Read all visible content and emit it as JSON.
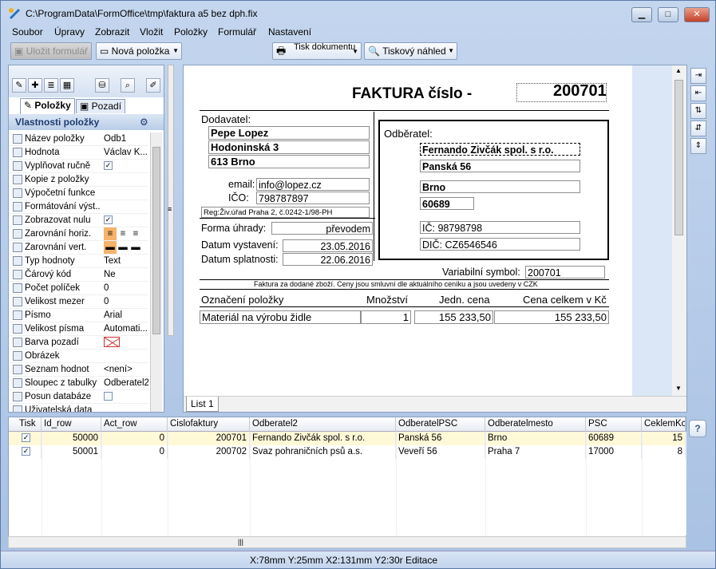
{
  "window": {
    "title": "C:\\ProgramData\\FormOffice\\tmp\\faktura a5 bez dph.fix",
    "min": "▁",
    "max": "□",
    "close": "✕"
  },
  "menu": [
    "Soubor",
    "Úpravy",
    "Zobrazit",
    "Vložit",
    "Položky",
    "Formulář",
    "Nastavení"
  ],
  "toolbar": {
    "save": "Uložit formulář",
    "new_item": "Nová položka",
    "print": "Tisk dokumentu",
    "preview": "Tiskový náhled"
  },
  "left_tabs": {
    "polozky": "Položky",
    "pozadi": "Pozadí"
  },
  "props_header": "Vlastnosti položky",
  "props": [
    {
      "name": "Název položky",
      "value": "Odb1",
      "icon": "label-icon"
    },
    {
      "name": "Hodnota",
      "value": "Václav K...",
      "icon": "value-icon"
    },
    {
      "name": "Vyplňovat ručně",
      "value": "check",
      "icon": "edit-icon"
    },
    {
      "name": "Kopie z položky",
      "value": "",
      "icon": "copy-icon"
    },
    {
      "name": "Výpočetní funkce",
      "value": "",
      "icon": "lightning-icon"
    },
    {
      "name": "Formátování výst...",
      "value": "",
      "icon": "format-icon"
    },
    {
      "name": "Zobrazovat nulu",
      "value": "check",
      "icon": "zero-icon"
    },
    {
      "name": "Zarovnání horiz.",
      "value": "align-h",
      "icon": "align-h-icon"
    },
    {
      "name": "Zarovnání vert.",
      "value": "align-v",
      "icon": "align-v-icon"
    },
    {
      "name": "Typ hodnoty",
      "value": "Text",
      "icon": "type-icon"
    },
    {
      "name": "Čárový kód",
      "value": "Ne",
      "icon": "barcode-icon"
    },
    {
      "name": "Počet políček",
      "value": "0",
      "icon": "count-icon"
    },
    {
      "name": "Velikost mezer",
      "value": "0",
      "icon": "spacing-icon"
    },
    {
      "name": "Písmo",
      "value": "Arial",
      "icon": "font-icon"
    },
    {
      "name": "Velikost písma",
      "value": "Automati...",
      "icon": "font-size-icon"
    },
    {
      "name": "Barva pozadí",
      "value": "none",
      "icon": "color-icon"
    },
    {
      "name": "Obrázek",
      "value": "",
      "icon": "image-icon"
    },
    {
      "name": "Seznam hodnot",
      "value": "<není>",
      "icon": "list-icon"
    },
    {
      "name": "Sloupec z tabulky",
      "value": "Odberatel2",
      "icon": "column-icon"
    },
    {
      "name": "Posun databáze",
      "value": "uncheck",
      "icon": "db-icon"
    },
    {
      "name": "Uživatelská data",
      "value": "",
      "icon": "user-data-icon"
    }
  ],
  "invoice": {
    "title": "FAKTURA číslo -",
    "number": "200701",
    "dodavatel_label": "Dodavatel:",
    "sup_name": "Pepe Lopez",
    "sup_street": "Hodoninská 3",
    "sup_city": "613 Brno",
    "email_label": "email:",
    "email": "info@lopez.cz",
    "ico_label": "IČO:",
    "ico": "798787897",
    "reg": "Reg:Živ.úřad Praha 2, č.0242-1/98-PH",
    "odberatel_label": "Odběratel:",
    "cust_name": "Fernando Zivčák spol. s r.o.",
    "cust_street": "Panská 56",
    "cust_city": "Brno",
    "cust_zip": "60689",
    "cust_ic": "IČ:  98798798",
    "cust_dic": "DIČ:  CZ6546546",
    "forma_label": "Forma úhrady:",
    "forma": "převodem",
    "vyst_label": "Datum vystavení:",
    "vyst": "23.05.2016",
    "splat_label": "Datum splatnosti:",
    "splat": "22.06.2016",
    "vs_label": "Variabilní symbol:",
    "vs": "200701",
    "note": "Faktura za dodané zboží. Ceny jsou smluvní dle aktuálního ceníku a jsou uvedeny v CZK",
    "col_item": "Označení položky",
    "col_qty": "Množství",
    "col_unit": "Jedn. cena",
    "col_total": "Cena celkem v Kč",
    "item": "Materiál na výrobu židle",
    "qty": "1",
    "unit": "155 233,50",
    "total": "155 233,50"
  },
  "sheet_tab": "List 1",
  "grid": {
    "headers": [
      "Tisk",
      "Id_row",
      "Act_row",
      "Cislofaktury",
      "Odberatel2",
      "OdberatelPSC",
      "Odberatelmesto",
      "PSC",
      "CeklemKc"
    ],
    "rows": [
      [
        "✓",
        "50000",
        "0",
        "200701",
        "Fernando Zivčák spol. s r.o.",
        "Panská 56",
        "Brno",
        "60689",
        "15"
      ],
      [
        "✓",
        "50001",
        "0",
        "200702",
        "Svaz pohraničních psů a.s.",
        "Veveří 56",
        "Praha 7",
        "17000",
        "8"
      ]
    ]
  },
  "help": "?",
  "status": "X:78mm  Y:25mm  X2:131mm  Y2:30r  Editace"
}
